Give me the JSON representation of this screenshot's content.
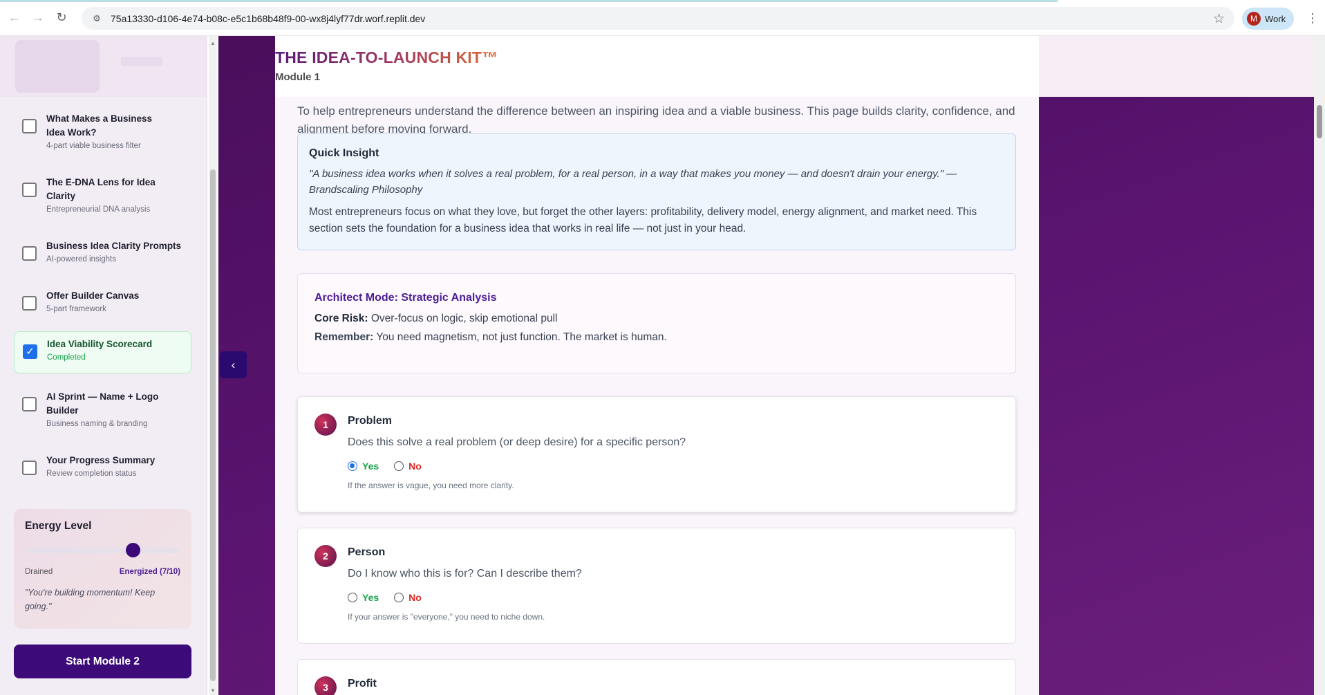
{
  "browser": {
    "url": "75a13330-d106-4e74-b08c-e5c1b68b48f9-00-wx8j4lyf77dr.worf.replit.dev",
    "profile_initial": "M",
    "profile_name": "Work"
  },
  "header": {
    "brand": "THE IDEA-TO-LAUNCH KIT™",
    "module": "Module 1"
  },
  "sidebar": {
    "items": [
      {
        "title": "What Makes a Business Idea Work?",
        "subtitle": "4-part viable business filter",
        "checked": false
      },
      {
        "title": "The E-DNA Lens for Idea Clarity",
        "subtitle": "Entrepreneurial DNA analysis",
        "checked": false
      },
      {
        "title": "Business Idea Clarity Prompts",
        "subtitle": "AI-powered insights",
        "checked": false
      },
      {
        "title": "Offer Builder Canvas",
        "subtitle": "5-part framework",
        "checked": false
      },
      {
        "title": "Idea Viability Scorecard",
        "subtitle": "Completed",
        "checked": true
      },
      {
        "title": "AI Sprint — Name + Logo Builder",
        "subtitle": "Business naming & branding",
        "checked": false
      },
      {
        "title": "Your Progress Summary",
        "subtitle": "Review completion status",
        "checked": false
      }
    ],
    "energy": {
      "title": "Energy Level",
      "min_label": "Drained",
      "value_label": "Energized (7/10)",
      "value": 7,
      "max": 10,
      "quote": "\"You're building momentum! Keep going.\""
    },
    "start_button": "Start Module 2"
  },
  "main": {
    "intro": "To help entrepreneurs understand the difference between an inspiring idea and a viable business. This page builds clarity, confidence, and alignment before moving forward.",
    "insight": {
      "title": "Quick Insight",
      "quote": "\"A business idea works when it solves a real problem, for a real person, in a way that makes you money — and doesn't drain your energy.\" — Brandscaling Philosophy",
      "body": "Most entrepreneurs focus on what they love, but forget the other layers: profitability, delivery model, energy alignment, and market need. This section sets the foundation for a business idea that works in real life — not just in your head."
    },
    "architect": {
      "title": "Architect Mode: Strategic Analysis",
      "risk_label": "Core Risk:",
      "risk_text": "Over-focus on logic, skip emotional pull",
      "remember_label": "Remember:",
      "remember_text": "You need magnetism, not just function. The market is human."
    },
    "questions": [
      {
        "number": "1",
        "title": "Problem",
        "question": "Does this solve a real problem (or deep desire) for a specific person?",
        "yes": "Yes",
        "no": "No",
        "selected": "yes",
        "hint": "If the answer is vague, you need more clarity."
      },
      {
        "number": "2",
        "title": "Person",
        "question": "Do I know who this is for? Can I describe them?",
        "yes": "Yes",
        "no": "No",
        "selected": "",
        "hint": "If your answer is \"everyone,\" you need to niche down."
      },
      {
        "number": "3",
        "title": "Profit"
      }
    ]
  },
  "colors": {
    "accent_purple": "#3d0b79",
    "completed_green": "#16a34a",
    "no_red": "#dc2626"
  }
}
